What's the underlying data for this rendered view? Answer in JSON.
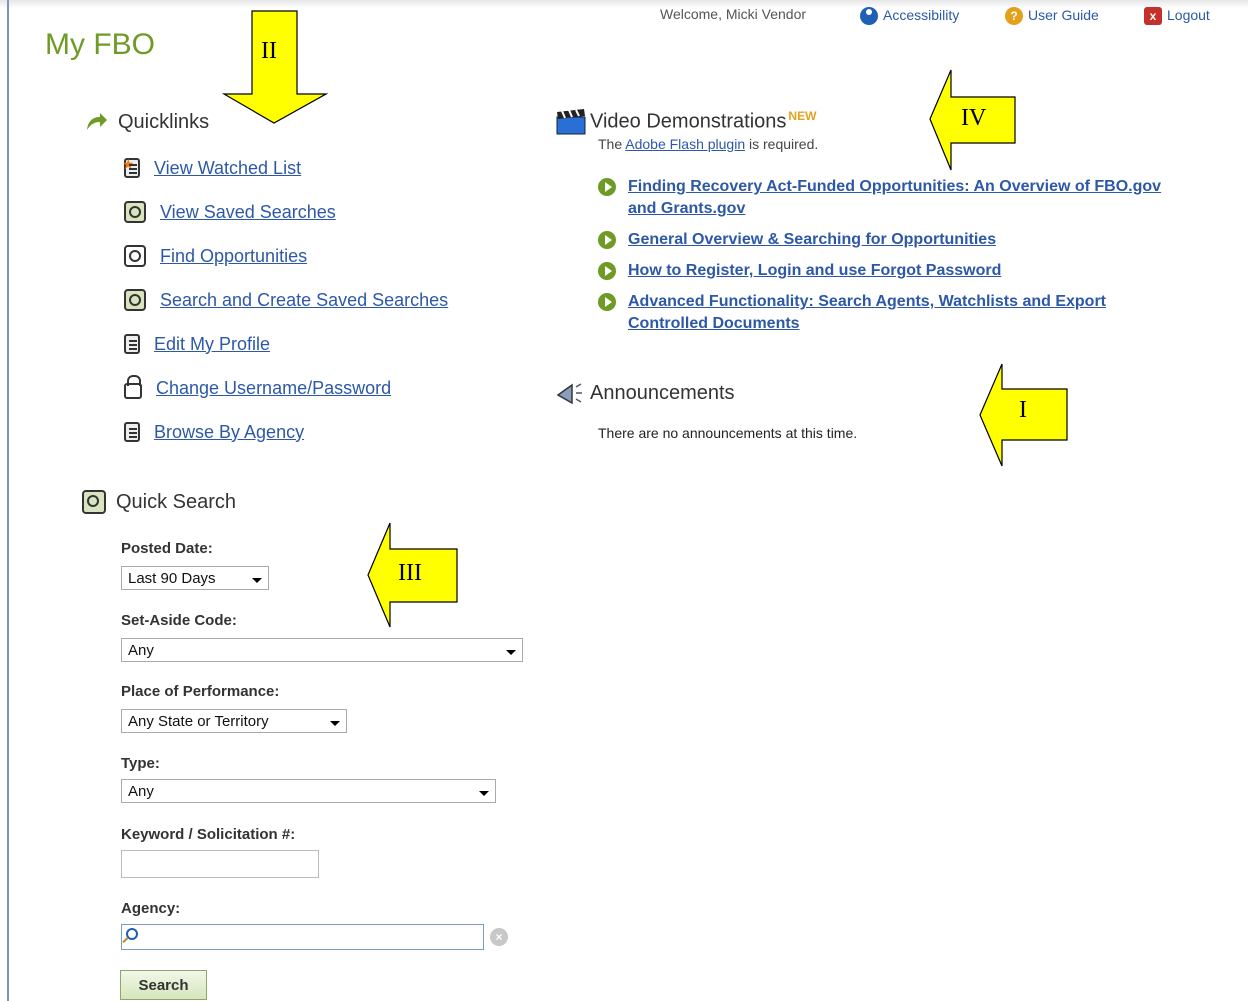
{
  "topnav": {
    "welcome": "Welcome, Micki Vendor",
    "accessibility": "Accessibility",
    "user_guide": "User Guide",
    "logout": "Logout"
  },
  "page_title": "My FBO",
  "quicklinks": {
    "heading": "Quicklinks",
    "items": [
      {
        "label": "View Watched List",
        "icon": "watched-list-icon"
      },
      {
        "label": "View Saved Searches",
        "icon": "saved-searches-icon"
      },
      {
        "label": "Find Opportunities",
        "icon": "find-icon"
      },
      {
        "label": "Search and Create Saved Searches",
        "icon": "saved-searches-icon"
      },
      {
        "label": "Edit My Profile",
        "icon": "profile-icon"
      },
      {
        "label": "Change Username/Password",
        "icon": "lock-icon"
      },
      {
        "label": "Browse By Agency",
        "icon": "document-icon"
      }
    ]
  },
  "video": {
    "heading": "Video Demonstrations",
    "new_badge": "NEW",
    "sub_prefix": "The ",
    "sub_link": "Adobe Flash plugin",
    "sub_suffix": " is required.",
    "items": [
      "Finding Recovery Act-Funded Opportunities: An Overview of FBO.gov and Grants.gov",
      "General Overview & Searching for Opportunities",
      "How to Register, Login and use Forgot Password",
      "Advanced Functionality: Search Agents, Watchlists and Export Controlled Documents"
    ]
  },
  "announcements": {
    "heading": "Announcements",
    "text": "There are no announcements at this time."
  },
  "quick_search": {
    "heading": "Quick Search",
    "posted_date_label": "Posted Date:",
    "posted_date_value": "Last 90 Days",
    "set_aside_label": "Set-Aside Code:",
    "set_aside_value": "Any",
    "place_label": "Place of Performance:",
    "place_value": "Any State or Territory",
    "type_label": "Type:",
    "type_value": "Any",
    "keyword_label": "Keyword / Solicitation #:",
    "keyword_value": "",
    "agency_label": "Agency:",
    "agency_value": "",
    "search_button": "Search"
  },
  "callouts": {
    "c1": "II",
    "c2": "IV",
    "c3": "I",
    "c4": "III"
  },
  "colors": {
    "title_green": "#6e9b26",
    "link_blue": "#2d58a8",
    "callout_yellow": "#ffff00"
  }
}
